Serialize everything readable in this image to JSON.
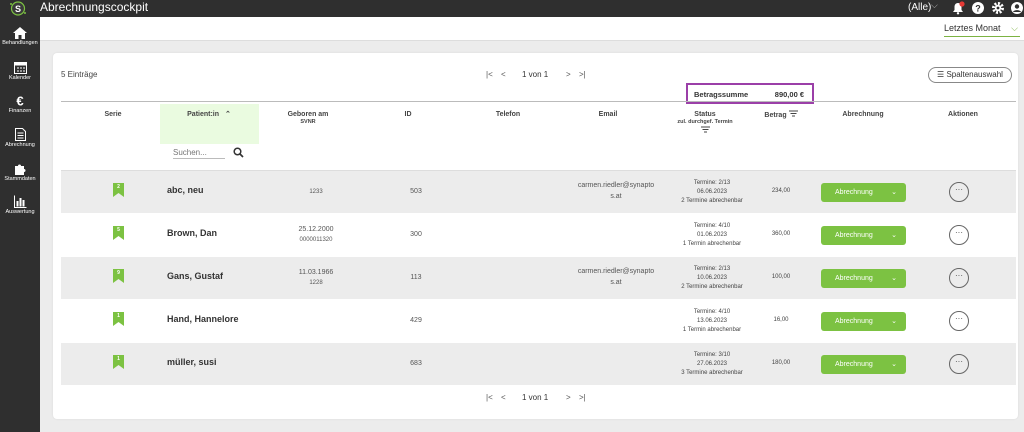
{
  "app": {
    "title": "Abrechnungscockpit",
    "filter_label": "(Alle)"
  },
  "colors": {
    "accent": "#7cc242",
    "topbar": "#2f2f2f",
    "highlight": "#9b3fa8"
  },
  "sidebar": {
    "items": [
      {
        "label": "Behandlungen",
        "icon": "home-icon"
      },
      {
        "label": "Kalender",
        "icon": "calendar-icon"
      },
      {
        "label": "Finanzen",
        "icon": "euro-icon"
      },
      {
        "label": "Abrechnung",
        "icon": "document-icon"
      },
      {
        "label": "Stammdaten",
        "icon": "puzzle-icon"
      },
      {
        "label": "Auswertung",
        "icon": "chart-icon"
      }
    ]
  },
  "period": {
    "value": "Letztes Monat"
  },
  "list": {
    "entries_label": "5 Einträge",
    "page_label": "1 von 1",
    "columns_button": "Spaltenauswahl",
    "sum_label": "Betragssumme",
    "sum_value": "890,00 €",
    "search_placeholder": "Suchen...",
    "headers": {
      "serie": "Serie",
      "patient": "Patient:in",
      "born": "Geboren am",
      "born_sub": "SVNR",
      "id": "ID",
      "phone": "Telefon",
      "email": "Email",
      "status": "Status",
      "status_sub": "zul. durchgef. Termin",
      "amount": "Betrag",
      "billing": "Abrechnung",
      "actions": "Aktionen"
    },
    "button_label": "Abrechnung",
    "rows": [
      {
        "badge": "2",
        "name": "abc, neu",
        "born": "",
        "svnr": "1233",
        "id": "503",
        "email1": "carmen.riedler@synapto",
        "email2": "s.at",
        "status1": "Termine: 2/13",
        "status2": "06.06.2023",
        "status3": "2 Termine abrechenbar",
        "amount": "234,00"
      },
      {
        "badge": "5",
        "name": "Brown, Dan",
        "born": "25.12.2000",
        "svnr": "0000011320",
        "id": "300",
        "email1": "",
        "email2": "",
        "status1": "Termine: 4/10",
        "status2": "01.06.2023",
        "status3": "1 Termin abrechenbar",
        "amount": "360,00"
      },
      {
        "badge": "9",
        "name": "Gans, Gustaf",
        "born": "11.03.1966",
        "svnr": "1228",
        "id": "113",
        "email1": "carmen.riedler@synapto",
        "email2": "s.at",
        "status1": "Termine: 2/13",
        "status2": "10.06.2023",
        "status3": "2 Termine abrechenbar",
        "amount": "100,00"
      },
      {
        "badge": "1",
        "name": "Hand, Hannelore",
        "born": "",
        "svnr": "",
        "id": "429",
        "email1": "",
        "email2": "",
        "status1": "Termine: 4/10",
        "status2": "13.06.2023",
        "status3": "1 Termin abrechenbar",
        "amount": "16,00"
      },
      {
        "badge": "1",
        "name": "müller, susi",
        "born": "",
        "svnr": "",
        "id": "683",
        "email1": "",
        "email2": "",
        "status1": "Termine: 3/10",
        "status2": "27.06.2023",
        "status3": "3 Termine abrechenbar",
        "amount": "180,00"
      }
    ]
  }
}
